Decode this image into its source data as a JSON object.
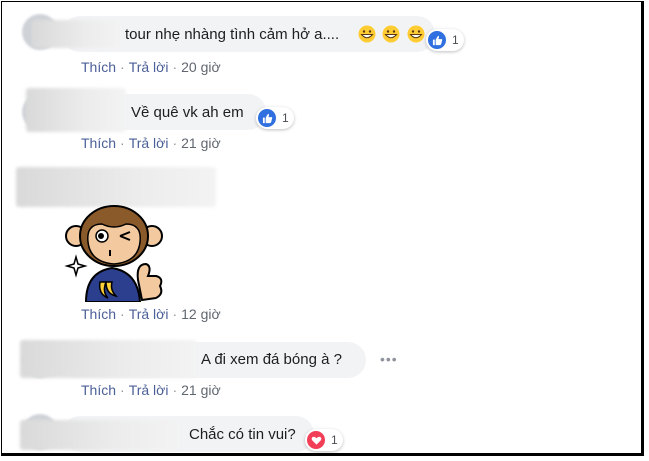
{
  "comments": [
    {
      "text": "tour nhẹ nhàng tình cảm hở a....",
      "emoji": [
        "grinning-face-icon",
        "grinning-face-icon",
        "grinning-face-icon"
      ],
      "reaction": {
        "icon": "like-icon",
        "count": "1"
      },
      "actions": {
        "like": "Thích",
        "reply": "Trả lời",
        "time": "20 giờ"
      }
    },
    {
      "text": "Về quê vk ah em",
      "reaction": {
        "icon": "like-icon",
        "count": "1"
      },
      "actions": {
        "like": "Thích",
        "reply": "Trả lời",
        "time": "21 giờ"
      }
    },
    {
      "sticker": "monkey-wink-sticker",
      "actions": {
        "like": "Thích",
        "reply": "Trả lời",
        "time": "12 giờ"
      }
    },
    {
      "text": "A đi xem đá bóng à ?",
      "more": "•••",
      "actions": {
        "like": "Thích",
        "reply": "Trả lời",
        "time": "21 giờ"
      }
    },
    {
      "text": "Chắc có tin vui?",
      "reaction": {
        "icon": "heart-icon",
        "count": "1"
      }
    }
  ],
  "separator": "·",
  "colors": {
    "link": "#4b5f98",
    "like": "#2f6fe0",
    "love": "#f33e58",
    "bubble": "#f2f3f5"
  }
}
